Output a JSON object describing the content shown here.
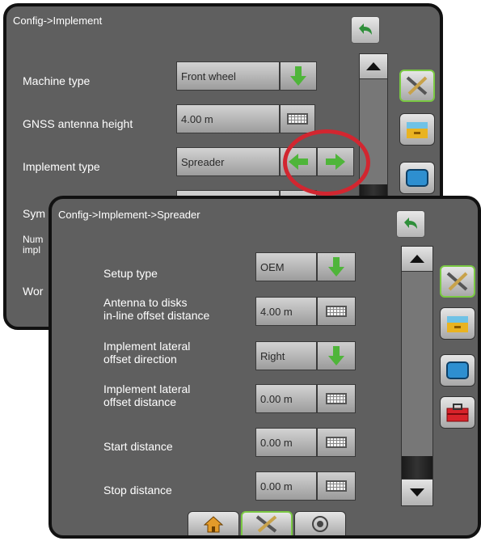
{
  "config_implement": {
    "title": "Config->Implement",
    "rows": [
      {
        "label": "Machine type",
        "value": "Front wheel"
      },
      {
        "label": "GNSS antenna height",
        "value": "4.00 m"
      },
      {
        "label": "Implement type",
        "value": "Spreader"
      },
      {
        "label": "Sym"
      },
      {
        "label": "Num\nimpl"
      },
      {
        "label": "Wor"
      }
    ]
  },
  "config_spreader": {
    "title": "Config->Implement->Spreader",
    "rows": [
      {
        "label": "Setup type",
        "value": "OEM"
      },
      {
        "label": "Antenna to disks\nin-line offset distance",
        "value": "4.00 m"
      },
      {
        "label": "Implement lateral\noffset direction",
        "value": "Right"
      },
      {
        "label": "Implement lateral\noffset distance",
        "value": "0.00 m"
      },
      {
        "label": "Start distance",
        "value": "0.00 m"
      },
      {
        "label": "Stop distance",
        "value": "0.00 m"
      }
    ]
  },
  "icons": {
    "back": "back-arrow-icon",
    "dropdown": "down-arrow-icon",
    "next": "right-arrow-icon",
    "prev": "left-arrow-icon",
    "keyboard": "keyboard-icon",
    "tools": "tools-icon",
    "console": "console-icon",
    "screen": "screen-icon",
    "toolbox": "toolbox-icon",
    "home": "home-icon",
    "gnss": "gnss-icon"
  },
  "colors": {
    "panel_bg": "#5f5f5f",
    "accent_green": "#7ac943",
    "highlight_red": "#d22630"
  }
}
